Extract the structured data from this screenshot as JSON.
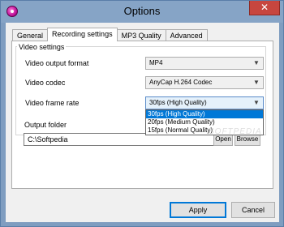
{
  "window": {
    "title": "Options",
    "close_glyph": "✕",
    "icon": "app-logo-icon"
  },
  "tabs": [
    {
      "label": "General"
    },
    {
      "label": "Recording settings",
      "active": true
    },
    {
      "label": "MP3 Quality"
    },
    {
      "label": "Advanced"
    }
  ],
  "video_settings": {
    "group_label": "Video settings",
    "output_format": {
      "label": "Video output format",
      "value": "MP4"
    },
    "codec": {
      "label": "Video codec",
      "value": "AnyCap H.264 Codec"
    },
    "frame_rate": {
      "label": "Video frame rate",
      "value": "30fps (High Quality)",
      "options": [
        "30fps (High Quality)",
        "20fps (Medium Quality)",
        "15fps (Normal Quality)"
      ]
    }
  },
  "output_folder": {
    "label": "Output folder",
    "path": "C:\\Softpedia",
    "open_label": "Open",
    "browse_label": "Browse"
  },
  "watermark": "SOFTPEDIA",
  "footer": {
    "apply_label": "Apply",
    "cancel_label": "Cancel"
  },
  "colors": {
    "accent": "#0078d7",
    "titlebar": "#86a4c6",
    "close": "#c7463f"
  }
}
